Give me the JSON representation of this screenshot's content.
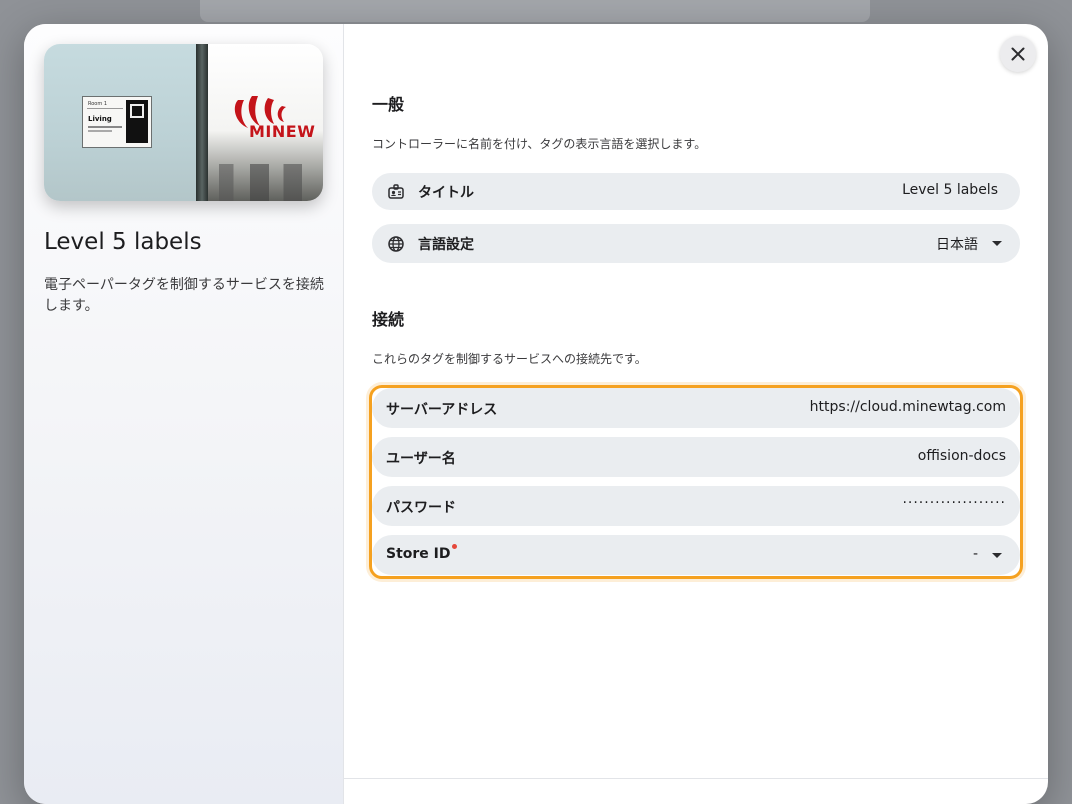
{
  "backdrop": {
    "title": ""
  },
  "sidebar": {
    "title": "Level 5 labels",
    "description": "電子ペーパータグを制御するサービスを接続します。",
    "preview": {
      "tag_heading": "Room 1",
      "tag_title": "Living",
      "logo_text": "MINEW",
      "logo_color": "#c4141a"
    }
  },
  "general": {
    "heading": "一般",
    "description": "コントローラーに名前を付け、タグの表示言語を選択します。",
    "title_row": {
      "label": "タイトル",
      "value": "Level 5 labels",
      "icon": "id-card-icon"
    },
    "language_row": {
      "label": "言語設定",
      "value": "日本語",
      "icon": "globe-icon"
    }
  },
  "connection": {
    "heading": "接続",
    "description": "これらのタグを制御するサービスへの接続先です。",
    "highlight_color": "#f5a120",
    "server_row": {
      "label": "サーバーアドレス",
      "value": "https://cloud.minewtag.com"
    },
    "user_row": {
      "label": "ユーザー名",
      "value": "offision-docs"
    },
    "password_row": {
      "label": "パスワード",
      "value": "···················"
    },
    "store_row": {
      "label": "Store ID",
      "value": "-",
      "required": true,
      "required_color": "#e5483b"
    }
  },
  "close_label": "close"
}
